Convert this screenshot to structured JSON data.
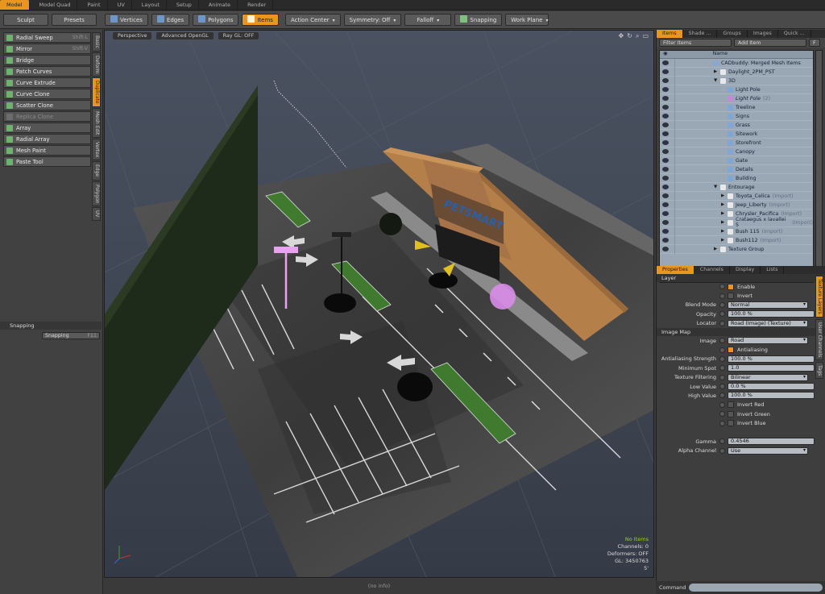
{
  "tabs": [
    "Model",
    "Model Quad",
    "Paint",
    "UV",
    "Layout",
    "Setup",
    "Animate",
    "Render"
  ],
  "toolbar": {
    "sculpt": "Sculpt",
    "presets": "Presets",
    "vertices": "Vertices",
    "edges": "Edges",
    "polygons": "Polygons",
    "items": "Items",
    "action_center": "Action Center",
    "symmetry": "Symmetry: Off",
    "falloff": "Falloff",
    "snapping": "Snapping",
    "work_plane": "Work Plane"
  },
  "tools": [
    {
      "label": "Radial Sweep",
      "shortcut": "Shift-L"
    },
    {
      "label": "Mirror",
      "shortcut": "Shift-V"
    },
    {
      "label": "Bridge",
      "shortcut": ""
    },
    {
      "label": "Patch Curves",
      "shortcut": ""
    },
    {
      "label": "Curve Extrude",
      "shortcut": ""
    },
    {
      "label": "Curve Clone",
      "shortcut": ""
    },
    {
      "label": "Scatter Clone",
      "shortcut": ""
    },
    {
      "label": "Replica Clone",
      "shortcut": ""
    },
    {
      "label": "Array",
      "shortcut": ""
    },
    {
      "label": "Radial Array",
      "shortcut": ""
    },
    {
      "label": "Mesh Paint",
      "shortcut": ""
    },
    {
      "label": "Paste Tool",
      "shortcut": ""
    }
  ],
  "side_tabs": [
    "Basic",
    "Deform",
    "Duplicate",
    "Mesh Edit",
    "Vertex",
    "Edge",
    "Polygon",
    "UV"
  ],
  "snapping_panel": {
    "title": "Snapping",
    "button": "Snapping",
    "shortcut": "F11"
  },
  "viewport": {
    "perspective": "Perspective",
    "shading": "Advanced OpenGL",
    "raygl": "Ray GL: OFF",
    "hud": {
      "items": "No Items",
      "channels": "Channels: 0",
      "deformers": "Deformers: OFF",
      "gl": "GL: 3450763",
      "unit": "5'"
    }
  },
  "status_info": "(no info)",
  "right_tabs": [
    "Items",
    "Shade ...",
    "Groups",
    "Images",
    "Quick ..."
  ],
  "filter": {
    "filter_label": "Filter Items",
    "add_label": "Add Item",
    "f": "F"
  },
  "list_header": "Name",
  "items": [
    {
      "name": "CADbuddy: Merged Mesh Items",
      "indent": 0,
      "arrow": "",
      "icon": "#8aa7cf",
      "suffix": ""
    },
    {
      "name": "Daylight_2PM_PST",
      "indent": 1,
      "arrow": "▶",
      "icon": "#e8e8e8",
      "suffix": ""
    },
    {
      "name": "3D",
      "indent": 1,
      "arrow": "▼",
      "icon": "#e8e8e8",
      "suffix": ""
    },
    {
      "name": "Light Pole",
      "indent": 2,
      "arrow": "",
      "icon": "#7fa6d4",
      "suffix": ""
    },
    {
      "name": "Light Pole",
      "indent": 2,
      "arrow": "",
      "icon": "#c48ad4",
      "suffix": "(2)",
      "italic": true
    },
    {
      "name": "Treeline",
      "indent": 2,
      "arrow": "",
      "icon": "#7fa6d4",
      "suffix": ""
    },
    {
      "name": "Signs",
      "indent": 2,
      "arrow": "",
      "icon": "#7fa6d4",
      "suffix": ""
    },
    {
      "name": "Grass",
      "indent": 2,
      "arrow": "",
      "icon": "#7fa6d4",
      "suffix": ""
    },
    {
      "name": "Sitework",
      "indent": 2,
      "arrow": "",
      "icon": "#7fa6d4",
      "suffix": ""
    },
    {
      "name": "Storefront",
      "indent": 2,
      "arrow": "",
      "icon": "#7fa6d4",
      "suffix": ""
    },
    {
      "name": "Canopy",
      "indent": 2,
      "arrow": "",
      "icon": "#7fa6d4",
      "suffix": ""
    },
    {
      "name": "Gate",
      "indent": 2,
      "arrow": "",
      "icon": "#7fa6d4",
      "suffix": ""
    },
    {
      "name": "Details",
      "indent": 2,
      "arrow": "",
      "icon": "#7fa6d4",
      "suffix": ""
    },
    {
      "name": "Building",
      "indent": 2,
      "arrow": "",
      "icon": "#7fa6d4",
      "suffix": ""
    },
    {
      "name": "Entourage",
      "indent": 1,
      "arrow": "▼",
      "icon": "#e8e8e8",
      "suffix": ""
    },
    {
      "name": "Toyota_Celica",
      "indent": 2,
      "arrow": "▶",
      "icon": "#e8e8e8",
      "suffix": "(Import)"
    },
    {
      "name": "Jeep_Liberty",
      "indent": 2,
      "arrow": "▶",
      "icon": "#e8e8e8",
      "suffix": "(Import)"
    },
    {
      "name": "Chrysler_Pacifica",
      "indent": 2,
      "arrow": "▶",
      "icon": "#e8e8e8",
      "suffix": "(Import)"
    },
    {
      "name": "Crataegus x lavallei 5",
      "indent": 2,
      "arrow": "▶",
      "icon": "#e8e8e8",
      "suffix": "(Import)"
    },
    {
      "name": "Bush 115",
      "indent": 2,
      "arrow": "▶",
      "icon": "#e8e8e8",
      "suffix": "(Import)"
    },
    {
      "name": "Bush112",
      "indent": 2,
      "arrow": "▶",
      "icon": "#e8e8e8",
      "suffix": "(Import)"
    },
    {
      "name": "Texture Group",
      "indent": 1,
      "arrow": "▶",
      "icon": "#e8e8e8",
      "suffix": ""
    }
  ],
  "prop_tabs": [
    "Properties",
    "Channels",
    "Display",
    "Lists"
  ],
  "layer": {
    "section": "Layer",
    "enable": "Enable",
    "invert": "Invert",
    "blend_mode_label": "Blend Mode",
    "blend_mode": "Normal",
    "opacity_label": "Opacity",
    "opacity": "100.0 %",
    "locator_label": "Locator",
    "locator": "Road (Image) (Texture)"
  },
  "image_map": {
    "section": "Image Map",
    "image_label": "Image",
    "image": "Road",
    "antialiasing": "Antialiasing",
    "aa_strength_label": "Antialiasing Strength",
    "aa_strength": "100.0 %",
    "min_spot_label": "Minimum Spot",
    "min_spot": "1.0",
    "filtering_label": "Texture Filtering",
    "filtering": "Bilinear",
    "low_label": "Low Value",
    "low": "0.0 %",
    "high_label": "High Value",
    "high": "100.0 %",
    "invert_red": "Invert Red",
    "invert_green": "Invert Green",
    "invert_blue": "Invert Blue",
    "gamma_label": "Gamma",
    "gamma": "0.4546",
    "alpha_label": "Alpha Channel",
    "alpha": "Use"
  },
  "right_vtabs": [
    "Texture Layers",
    "User Channels",
    "Tags"
  ],
  "command_label": "Command",
  "colors": {
    "accent": "#e8961e",
    "items_bg": "#9aa8b6"
  }
}
